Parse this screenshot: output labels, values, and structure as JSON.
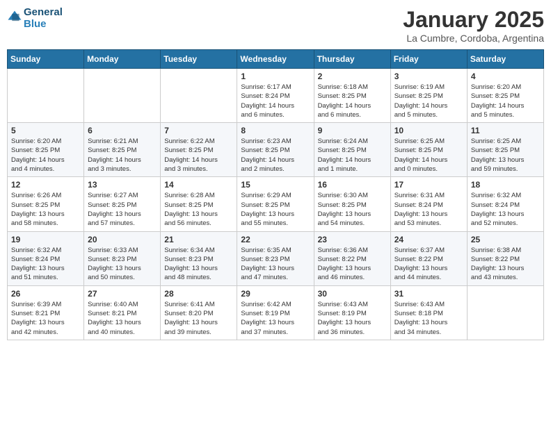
{
  "header": {
    "logo_line1": "General",
    "logo_line2": "Blue",
    "title": "January 2025",
    "location": "La Cumbre, Cordoba, Argentina"
  },
  "days_of_week": [
    "Sunday",
    "Monday",
    "Tuesday",
    "Wednesday",
    "Thursday",
    "Friday",
    "Saturday"
  ],
  "weeks": [
    [
      {
        "day": "",
        "info": ""
      },
      {
        "day": "",
        "info": ""
      },
      {
        "day": "",
        "info": ""
      },
      {
        "day": "1",
        "info": "Sunrise: 6:17 AM\nSunset: 8:24 PM\nDaylight: 14 hours\nand 6 minutes."
      },
      {
        "day": "2",
        "info": "Sunrise: 6:18 AM\nSunset: 8:25 PM\nDaylight: 14 hours\nand 6 minutes."
      },
      {
        "day": "3",
        "info": "Sunrise: 6:19 AM\nSunset: 8:25 PM\nDaylight: 14 hours\nand 5 minutes."
      },
      {
        "day": "4",
        "info": "Sunrise: 6:20 AM\nSunset: 8:25 PM\nDaylight: 14 hours\nand 5 minutes."
      }
    ],
    [
      {
        "day": "5",
        "info": "Sunrise: 6:20 AM\nSunset: 8:25 PM\nDaylight: 14 hours\nand 4 minutes."
      },
      {
        "day": "6",
        "info": "Sunrise: 6:21 AM\nSunset: 8:25 PM\nDaylight: 14 hours\nand 3 minutes."
      },
      {
        "day": "7",
        "info": "Sunrise: 6:22 AM\nSunset: 8:25 PM\nDaylight: 14 hours\nand 3 minutes."
      },
      {
        "day": "8",
        "info": "Sunrise: 6:23 AM\nSunset: 8:25 PM\nDaylight: 14 hours\nand 2 minutes."
      },
      {
        "day": "9",
        "info": "Sunrise: 6:24 AM\nSunset: 8:25 PM\nDaylight: 14 hours\nand 1 minute."
      },
      {
        "day": "10",
        "info": "Sunrise: 6:25 AM\nSunset: 8:25 PM\nDaylight: 14 hours\nand 0 minutes."
      },
      {
        "day": "11",
        "info": "Sunrise: 6:25 AM\nSunset: 8:25 PM\nDaylight: 13 hours\nand 59 minutes."
      }
    ],
    [
      {
        "day": "12",
        "info": "Sunrise: 6:26 AM\nSunset: 8:25 PM\nDaylight: 13 hours\nand 58 minutes."
      },
      {
        "day": "13",
        "info": "Sunrise: 6:27 AM\nSunset: 8:25 PM\nDaylight: 13 hours\nand 57 minutes."
      },
      {
        "day": "14",
        "info": "Sunrise: 6:28 AM\nSunset: 8:25 PM\nDaylight: 13 hours\nand 56 minutes."
      },
      {
        "day": "15",
        "info": "Sunrise: 6:29 AM\nSunset: 8:25 PM\nDaylight: 13 hours\nand 55 minutes."
      },
      {
        "day": "16",
        "info": "Sunrise: 6:30 AM\nSunset: 8:25 PM\nDaylight: 13 hours\nand 54 minutes."
      },
      {
        "day": "17",
        "info": "Sunrise: 6:31 AM\nSunset: 8:24 PM\nDaylight: 13 hours\nand 53 minutes."
      },
      {
        "day": "18",
        "info": "Sunrise: 6:32 AM\nSunset: 8:24 PM\nDaylight: 13 hours\nand 52 minutes."
      }
    ],
    [
      {
        "day": "19",
        "info": "Sunrise: 6:32 AM\nSunset: 8:24 PM\nDaylight: 13 hours\nand 51 minutes."
      },
      {
        "day": "20",
        "info": "Sunrise: 6:33 AM\nSunset: 8:23 PM\nDaylight: 13 hours\nand 50 minutes."
      },
      {
        "day": "21",
        "info": "Sunrise: 6:34 AM\nSunset: 8:23 PM\nDaylight: 13 hours\nand 48 minutes."
      },
      {
        "day": "22",
        "info": "Sunrise: 6:35 AM\nSunset: 8:23 PM\nDaylight: 13 hours\nand 47 minutes."
      },
      {
        "day": "23",
        "info": "Sunrise: 6:36 AM\nSunset: 8:22 PM\nDaylight: 13 hours\nand 46 minutes."
      },
      {
        "day": "24",
        "info": "Sunrise: 6:37 AM\nSunset: 8:22 PM\nDaylight: 13 hours\nand 44 minutes."
      },
      {
        "day": "25",
        "info": "Sunrise: 6:38 AM\nSunset: 8:22 PM\nDaylight: 13 hours\nand 43 minutes."
      }
    ],
    [
      {
        "day": "26",
        "info": "Sunrise: 6:39 AM\nSunset: 8:21 PM\nDaylight: 13 hours\nand 42 minutes."
      },
      {
        "day": "27",
        "info": "Sunrise: 6:40 AM\nSunset: 8:21 PM\nDaylight: 13 hours\nand 40 minutes."
      },
      {
        "day": "28",
        "info": "Sunrise: 6:41 AM\nSunset: 8:20 PM\nDaylight: 13 hours\nand 39 minutes."
      },
      {
        "day": "29",
        "info": "Sunrise: 6:42 AM\nSunset: 8:19 PM\nDaylight: 13 hours\nand 37 minutes."
      },
      {
        "day": "30",
        "info": "Sunrise: 6:43 AM\nSunset: 8:19 PM\nDaylight: 13 hours\nand 36 minutes."
      },
      {
        "day": "31",
        "info": "Sunrise: 6:43 AM\nSunset: 8:18 PM\nDaylight: 13 hours\nand 34 minutes."
      },
      {
        "day": "",
        "info": ""
      }
    ]
  ]
}
